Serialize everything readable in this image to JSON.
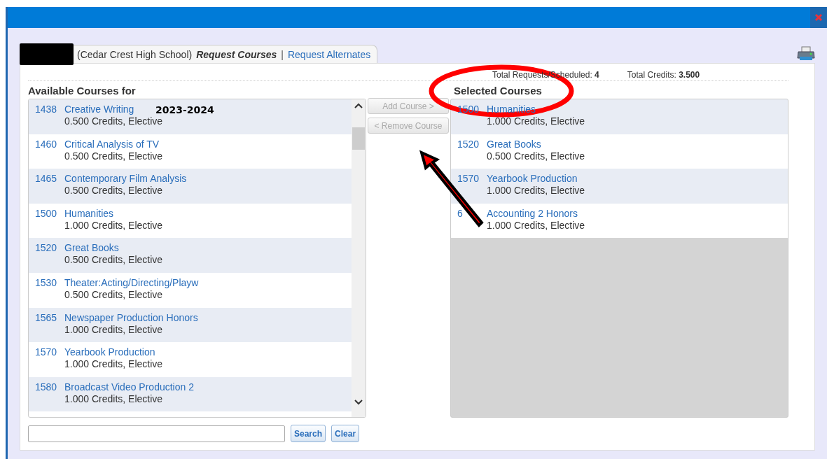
{
  "tab": {
    "school": "(Cedar Crest High School)",
    "current": "Request Courses",
    "separator": "|",
    "alternate": "Request Alternates"
  },
  "totals": [
    {
      "label": "Total Requests/Scheduled:",
      "value": "4"
    },
    {
      "label": "Total Credits:",
      "value": "3.500"
    }
  ],
  "available": {
    "heading": "Available Courses for",
    "year_label": "2023-2024",
    "rows": [
      {
        "code": "1438",
        "name": "Creative Writing",
        "details": "0.500 Credits,  Elective"
      },
      {
        "code": "1460",
        "name": "Critical Analysis of TV",
        "details": "0.500 Credits,  Elective"
      },
      {
        "code": "1465",
        "name": "Contemporary Film Analysis",
        "details": "0.500 Credits,  Elective"
      },
      {
        "code": "1500",
        "name": "Humanities",
        "details": "1.000 Credits,  Elective"
      },
      {
        "code": "1520",
        "name": "Great Books",
        "details": "0.500 Credits,  Elective"
      },
      {
        "code": "1530",
        "name": "Theater:Acting/Directing/Playw",
        "details": "0.500 Credits,  Elective"
      },
      {
        "code": "1565",
        "name": "Newspaper Production Honors",
        "details": "1.000 Credits,  Elective"
      },
      {
        "code": "1570",
        "name": "Yearbook Production",
        "details": "1.000 Credits,  Elective"
      },
      {
        "code": "1580",
        "name": "Broadcast Video Production 2",
        "details": "1.000 Credits,  Elective"
      }
    ]
  },
  "buttons": [
    {
      "label": "Add Course >",
      "disabled": true
    },
    {
      "label": "< Remove Course",
      "disabled": true
    }
  ],
  "selected": {
    "heading": "Selected Courses",
    "rows": [
      {
        "code": "1500",
        "name": "Humanities",
        "details": "1.000 Credits,  Elective"
      },
      {
        "code": "1520",
        "name": "Great Books",
        "details": "0.500 Credits,  Elective"
      },
      {
        "code": "1570",
        "name": "Yearbook Production",
        "details": "1.000 Credits,  Elective"
      },
      {
        "code": "6",
        "name": "Accounting 2 Honors",
        "details": "1.000 Credits,  Elective"
      }
    ]
  },
  "search": {
    "button": "Search",
    "clear": "Clear"
  }
}
